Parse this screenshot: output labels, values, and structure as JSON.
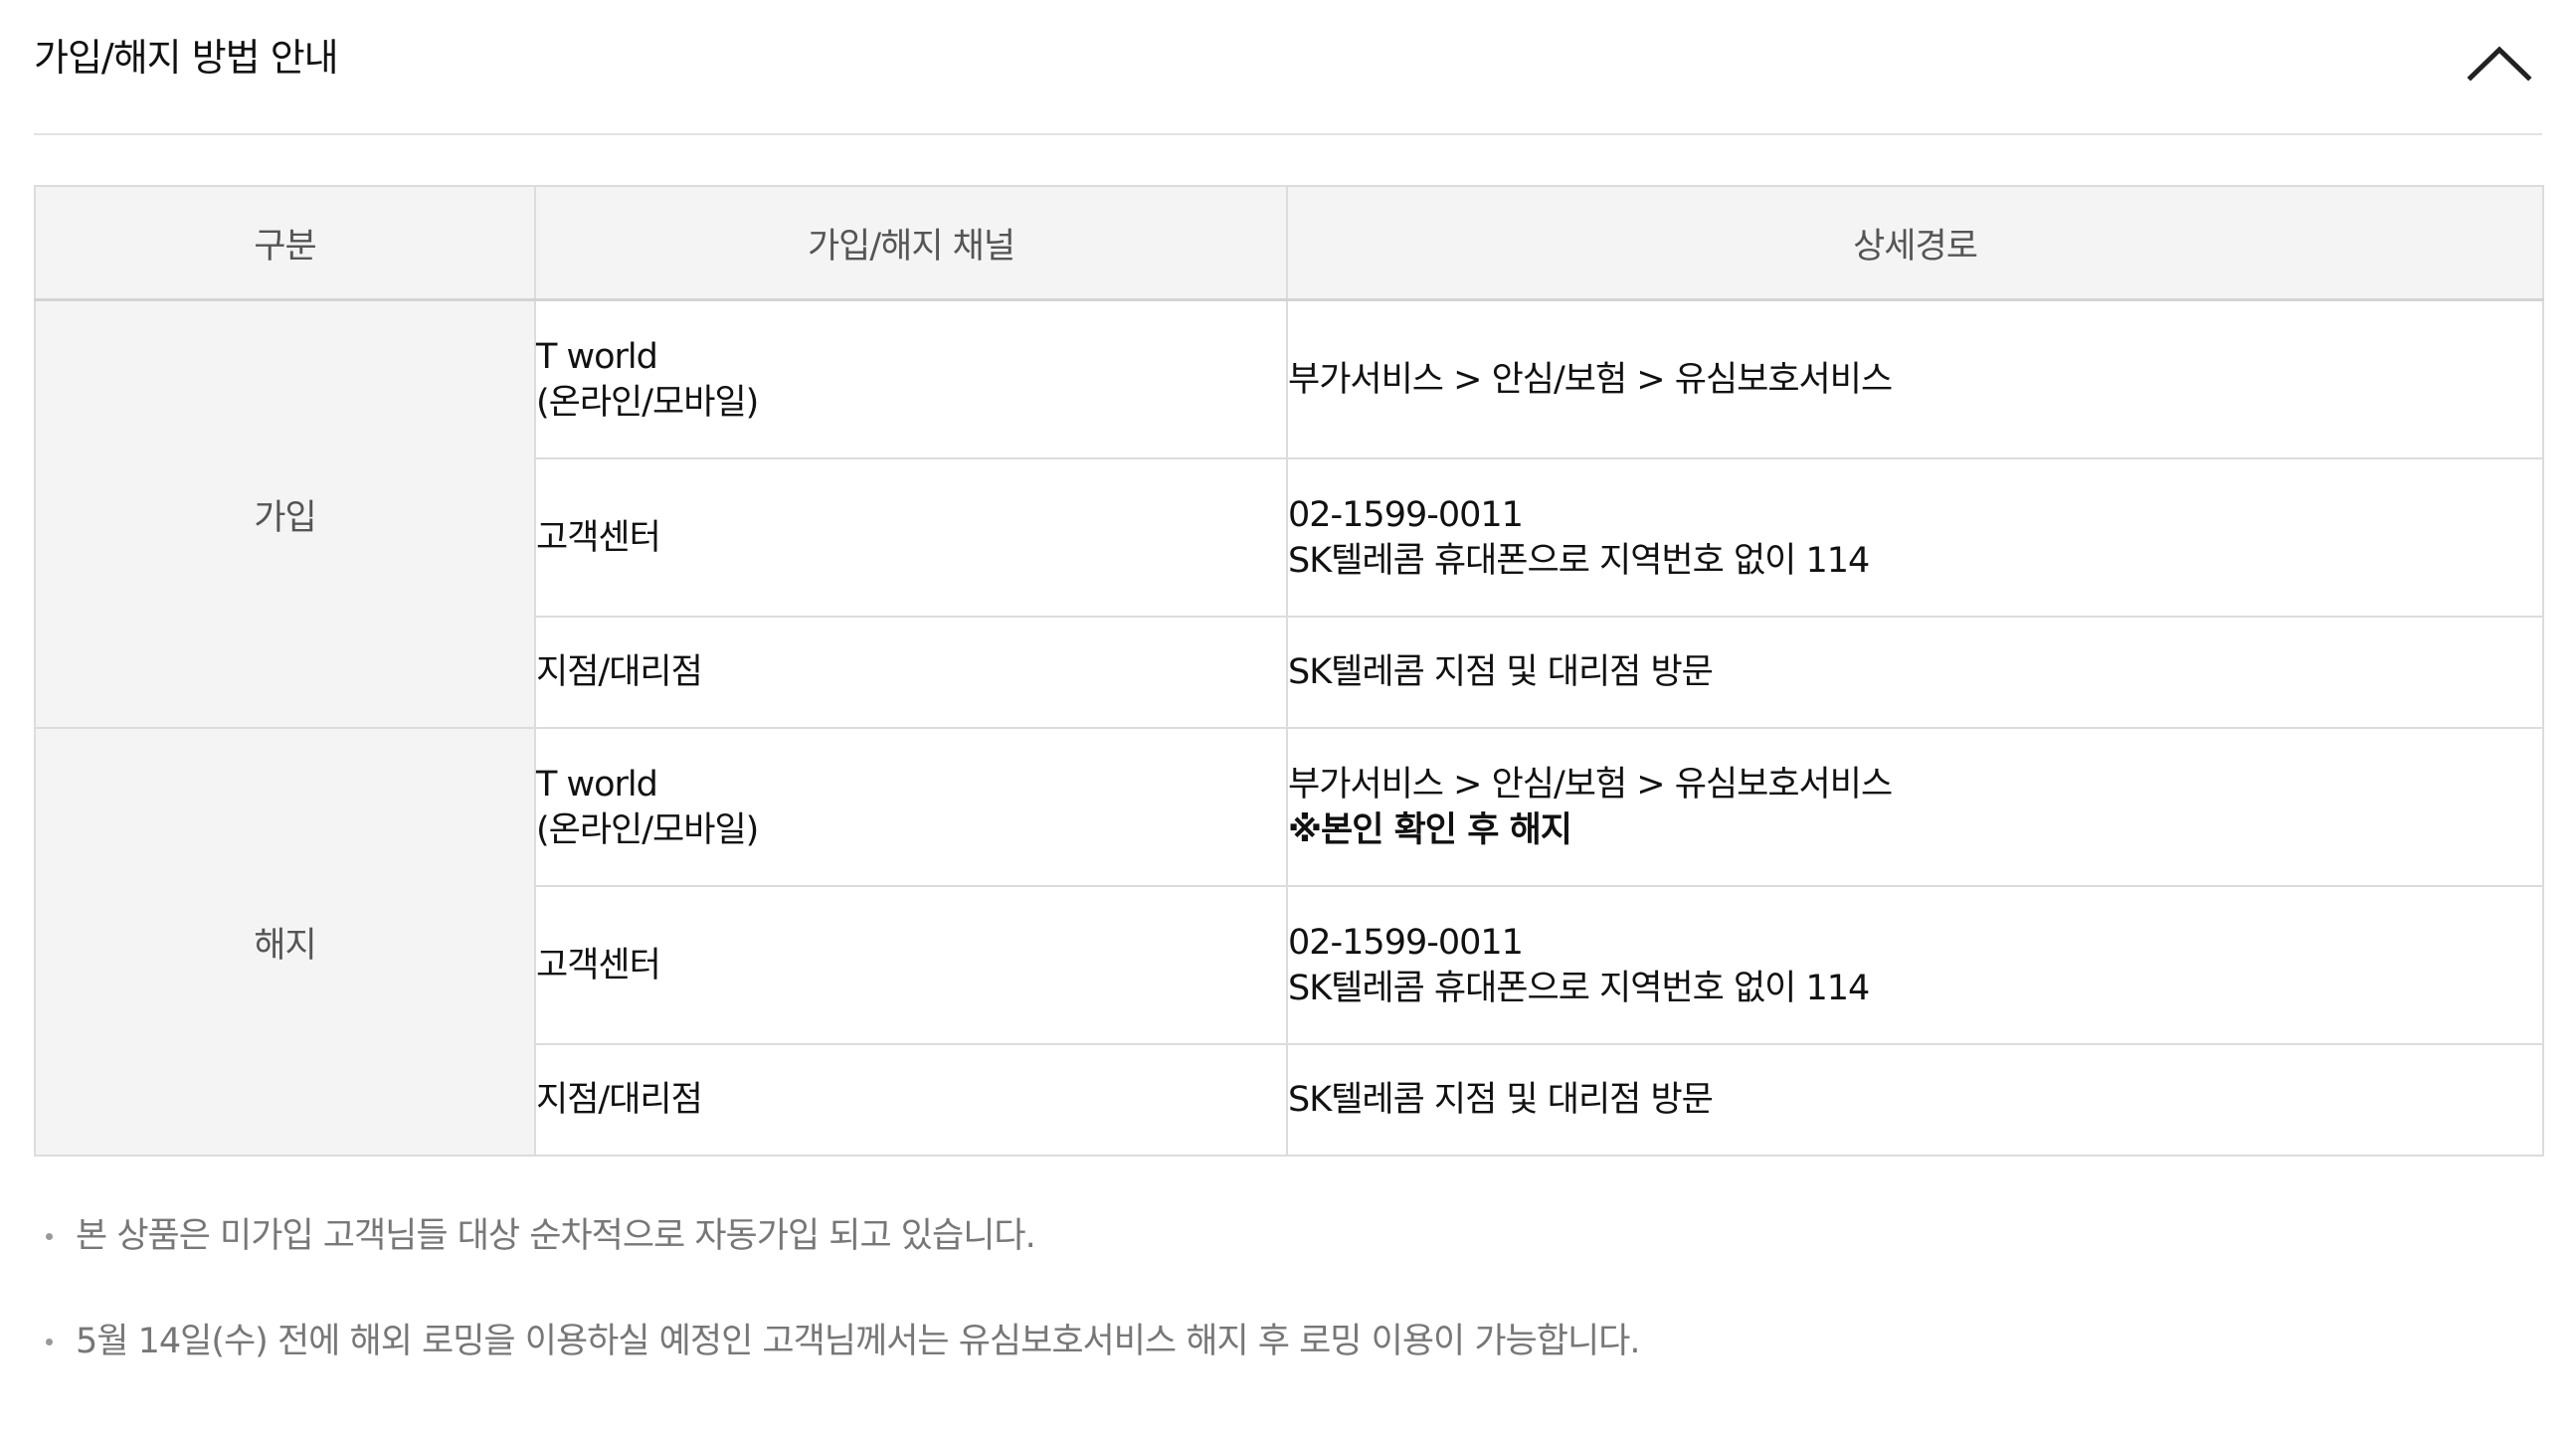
{
  "section": {
    "title": "가입/해지 방법 안내",
    "collapse_icon": "chevron-up-icon"
  },
  "table": {
    "headers": [
      "구분",
      "가입/해지 채널",
      "상세경로"
    ],
    "groups": [
      {
        "category": "가입",
        "rows": [
          {
            "channel_line1": "T world",
            "channel_line2": "(온라인/모바일)",
            "route_line1": "부가서비스 > 안심/보험 > 유심보호서비스",
            "route_line2": ""
          },
          {
            "channel_line1": "고객센터",
            "channel_line2": "",
            "route_line1": "02-1599-0011",
            "route_line2": "SK텔레콤 휴대폰으로 지역번호 없이 114"
          },
          {
            "channel_line1": "지점/대리점",
            "channel_line2": "",
            "route_line1": "SK텔레콤 지점 및 대리점 방문",
            "route_line2": ""
          }
        ]
      },
      {
        "category": "해지",
        "rows": [
          {
            "channel_line1": "T world",
            "channel_line2": "(온라인/모바일)",
            "route_line1": "부가서비스 > 안심/보험 > 유심보호서비스",
            "route_line2": "※본인 확인 후 해지"
          },
          {
            "channel_line1": "고객센터",
            "channel_line2": "",
            "route_line1": "02-1599-0011",
            "route_line2": "SK텔레콤 휴대폰으로 지역번호 없이 114"
          },
          {
            "channel_line1": "지점/대리점",
            "channel_line2": "",
            "route_line1": "SK텔레콤 지점 및 대리점 방문",
            "route_line2": ""
          }
        ]
      }
    ]
  },
  "notes": [
    "본 상품은 미가입 고객님들 대상 순차적으로 자동가입 되고 있습니다.",
    "5월 14일(수) 전에 해외 로밍을 이용하실 예정인 고객님께서는 유심보호서비스 해지 후 로밍 이용이 가능합니다."
  ]
}
